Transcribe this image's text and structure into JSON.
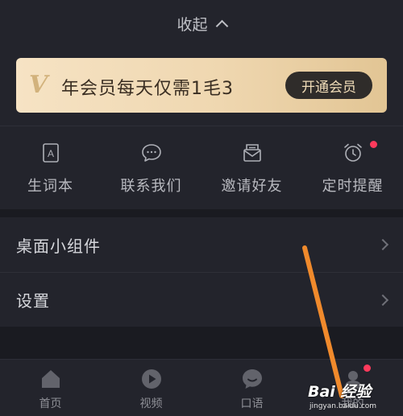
{
  "collapse": {
    "label": "收起",
    "icon": "chevron-up-icon"
  },
  "vip": {
    "logo": "V",
    "text": "年会员每天仅需1毛3",
    "button": "开通会员",
    "colors": {
      "gold_start": "#f6e3c4",
      "gold_end": "#e2c594",
      "button_bg": "#2f2c2a",
      "button_text": "#f0dcb8"
    }
  },
  "quick_actions": [
    {
      "label": "生词本",
      "icon": "vocabulary-book-icon"
    },
    {
      "label": "联系我们",
      "icon": "chat-bubble-icon"
    },
    {
      "label": "邀请好友",
      "icon": "invite-envelope-icon"
    },
    {
      "label": "定时提醒",
      "icon": "alarm-clock-icon",
      "badge": true
    }
  ],
  "menu": [
    {
      "label": "桌面小组件",
      "icon": "chevron-right-icon"
    },
    {
      "label": "设置",
      "icon": "chevron-right-icon"
    }
  ],
  "tabs": [
    {
      "label": "首页",
      "icon": "home-icon"
    },
    {
      "label": "视频",
      "icon": "play-icon"
    },
    {
      "label": "口语",
      "icon": "speech-icon"
    },
    {
      "label": "我的",
      "icon": "profile-icon",
      "badge": true
    }
  ],
  "watermark": {
    "brand": "Bai 经验",
    "url": "jingyan.baidu.com"
  },
  "colors": {
    "background": "#1c1d24",
    "panel": "#23242c",
    "badge": "#ff3a5c",
    "annotation_arrow": "#f08a2c"
  }
}
